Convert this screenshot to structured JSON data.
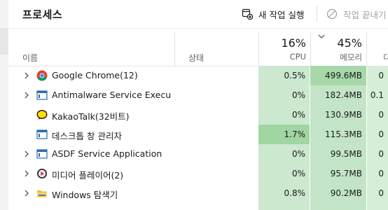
{
  "header": {
    "title": "프로세스",
    "new_task_label": "새 작업 실행",
    "end_task_label": "작업 끝내기"
  },
  "columns": {
    "name": "이름",
    "status": "상태",
    "cpu": {
      "pct": "16%",
      "label": "CPU"
    },
    "memory": {
      "pct": "45%",
      "label": "메모리"
    },
    "disk": {
      "label": "디"
    }
  },
  "processes": [
    {
      "name": "Google Chrome(12)",
      "icon": "chrome-icon",
      "expandable": true,
      "cpu": "0.5%",
      "memory": "499.6MB",
      "disk": "0"
    },
    {
      "name": "Antimalware Service Executa...",
      "icon": "window-app-icon",
      "expandable": true,
      "cpu": "0%",
      "memory": "182.4MB",
      "disk": "0.1"
    },
    {
      "name": "KakaoTalk(32비트)",
      "icon": "kakaotalk-icon",
      "expandable": false,
      "cpu": "0%",
      "memory": "130.9MB",
      "disk": "0"
    },
    {
      "name": "데스크톱 창 관리자",
      "icon": "window-app-icon",
      "expandable": false,
      "cpu": "1.7%",
      "memory": "115.3MB",
      "disk": "0"
    },
    {
      "name": "ASDF Service Application",
      "icon": "window-app-icon",
      "expandable": true,
      "cpu": "0%",
      "memory": "99.5MB",
      "disk": "0"
    },
    {
      "name": "미디어 플레이어(2)",
      "icon": "media-player-icon",
      "expandable": true,
      "cpu": "0%",
      "memory": "95.7MB",
      "disk": "0"
    },
    {
      "name": "Windows 탐색기",
      "icon": "folder-icon",
      "expandable": true,
      "cpu": "0.8%",
      "memory": "90.2MB",
      "disk": "0"
    }
  ]
}
